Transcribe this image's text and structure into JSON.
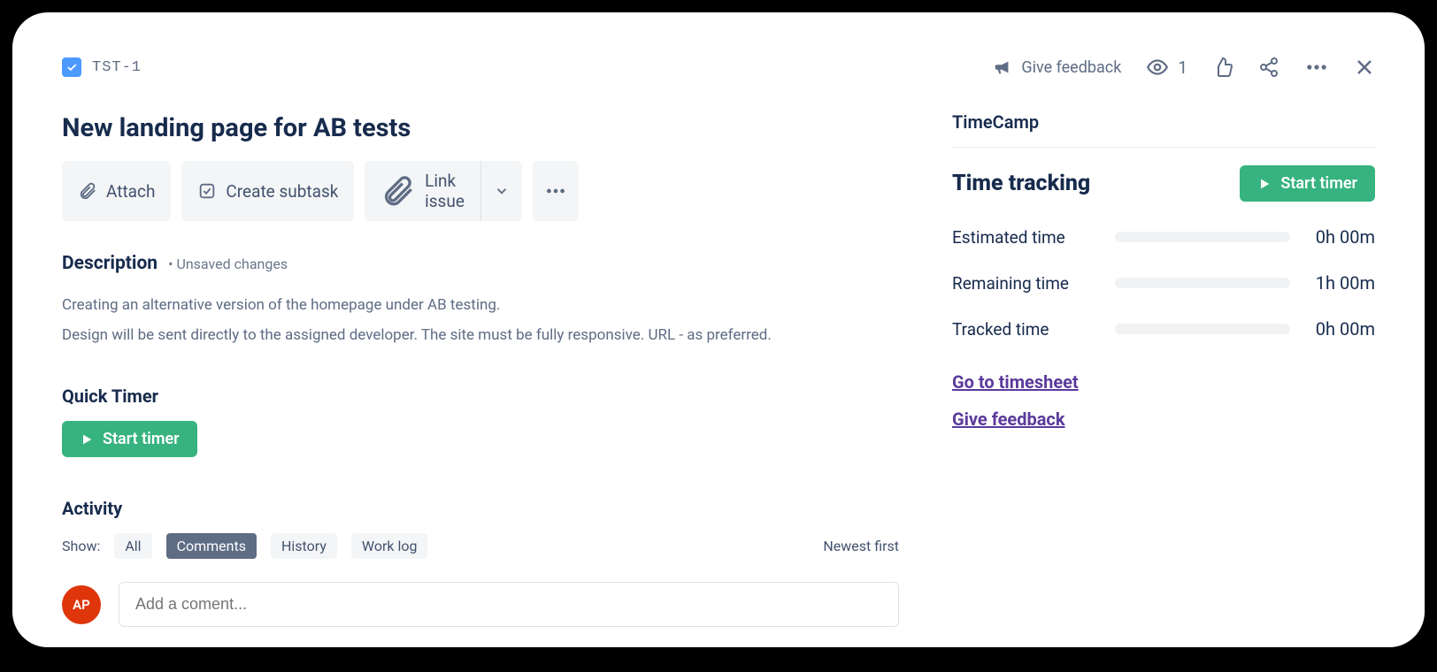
{
  "issue": {
    "key": "TST-1",
    "title": "New landing page for AB tests"
  },
  "top": {
    "feedback": "Give feedback",
    "watch_count": "1"
  },
  "actions": {
    "attach": "Attach",
    "create_subtask": "Create subtask",
    "link_issue": "Link issue"
  },
  "description": {
    "heading": "Description",
    "unsaved": "Unsaved changes",
    "line1": "Creating an alternative version of the homepage under AB testing.",
    "line2": "Design will be sent directly to the assigned developer. The site must be fully responsive. URL - as preferred."
  },
  "quick_timer": {
    "heading": "Quick Timer",
    "button": "Start timer"
  },
  "activity": {
    "heading": "Activity",
    "show": "Show:",
    "tabs": {
      "all": "All",
      "comments": "Comments",
      "history": "History",
      "worklog": "Work log"
    },
    "sort": "Newest first",
    "avatar": "AP",
    "placeholder": "Add a coment..."
  },
  "side": {
    "app": "TimeCamp",
    "heading": "Time tracking",
    "start": "Start timer",
    "estimated": {
      "label": "Estimated time",
      "value": "0h 00m"
    },
    "remaining": {
      "label": "Remaining time",
      "value": "1h 00m"
    },
    "tracked": {
      "label": "Tracked time",
      "value": "0h 00m"
    },
    "link_timesheet": "Go to timesheet",
    "link_feedback": "Give feedback"
  }
}
